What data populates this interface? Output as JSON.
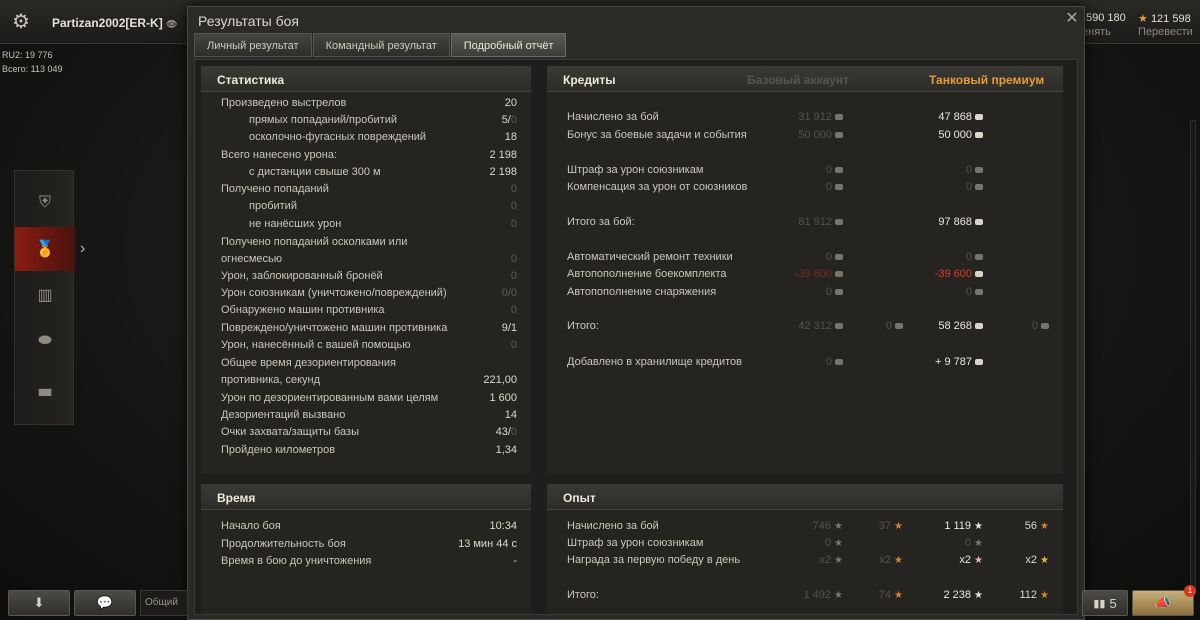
{
  "topbar": {
    "player_name": "Partizan2002[ER-K]",
    "ratings": [
      "RU2: 19 776",
      "Всего: 113 049"
    ],
    "credits_value": "590 180",
    "credits_sub": "енять",
    "gold_value": "121 598",
    "gold_sub": "Перевести"
  },
  "dialog": {
    "title": "Результаты боя",
    "tabs": [
      {
        "label": "Личный результат",
        "active": false
      },
      {
        "label": "Командный результат",
        "active": false
      },
      {
        "label": "Подробный отчёт",
        "active": true
      }
    ]
  },
  "stats": {
    "title": "Статистика",
    "rows": [
      {
        "label": "Произведено выстрелов",
        "value": "20",
        "indent": false,
        "dim": false
      },
      {
        "label": "прямых попаданий/пробитий",
        "value": "5/",
        "value_dim": "0",
        "indent": true
      },
      {
        "label": "осколочно-фугасных повреждений",
        "value": "18",
        "indent": true,
        "dim": false
      },
      {
        "label": "Всего нанесено урона:",
        "value": "2 198",
        "indent": false,
        "dim": false
      },
      {
        "label": "с дистанции свыше 300 м",
        "value": "2 198",
        "indent": true,
        "dim": false
      },
      {
        "label": "Получено попаданий",
        "value": "0",
        "indent": false,
        "dim": true
      },
      {
        "label": "пробитий",
        "value": "0",
        "indent": true,
        "dim": true
      },
      {
        "label": "не нанёсших урон",
        "value": "0",
        "indent": true,
        "dim": true
      },
      {
        "label": "Получено попаданий осколками или",
        "value": "",
        "indent": false,
        "dim": false
      },
      {
        "label": "огнесмесью",
        "value": "0",
        "indent": false,
        "dim": true
      },
      {
        "label": "Урон, заблокированный бронёй",
        "value": "0",
        "indent": false,
        "dim": true
      },
      {
        "label": "Урон союзникам (уничтожено/повреждений)",
        "value": "0/0",
        "indent": false,
        "dim": true
      },
      {
        "label": "Обнаружено машин противника",
        "value": "0",
        "indent": false,
        "dim": true
      },
      {
        "label": "Повреждено/уничтожено машин противника",
        "value": "9/1",
        "indent": false,
        "dim": false
      },
      {
        "label": "Урон, нанесённый с вашей помощью",
        "value": "0",
        "indent": false,
        "dim": true
      },
      {
        "label": "Общее время дезориентирования",
        "value": "",
        "indent": false,
        "dim": false
      },
      {
        "label": "противника, секунд",
        "value": "221,00",
        "indent": false,
        "dim": false
      },
      {
        "label": "Урон по дезориентированным вами целям",
        "value": "1 600",
        "indent": false,
        "dim": false
      },
      {
        "label": "Дезориентаций вызвано",
        "value": "14",
        "indent": false,
        "dim": false
      },
      {
        "label": "Очки захвата/защиты базы",
        "value": "43/",
        "value_dim": "0",
        "indent": false
      },
      {
        "label": "Пройдено километров",
        "value": "1,34",
        "indent": false,
        "dim": false
      }
    ]
  },
  "time": {
    "title": "Время",
    "rows": [
      {
        "label": "Начало боя",
        "value": "10:34"
      },
      {
        "label": "Продолжительность боя",
        "value": "13 мин 44 с"
      },
      {
        "label": "Время в бою до уничтожения",
        "value": "-"
      }
    ]
  },
  "credits": {
    "title": "Кредиты",
    "header_base": "Базовый аккаунт",
    "header_premium": "Танковый премиум",
    "rows": [
      {
        "label": "Начислено за бой",
        "base": "31 912",
        "prem": "47 868"
      },
      {
        "label": "Бонус за боевые задачи и события",
        "base": "50 000",
        "prem": "50 000"
      },
      {
        "label": "Штраф за урон союзникам",
        "base": "0",
        "prem": "0"
      },
      {
        "label": "Компенсация за урон от союзников",
        "base": "0",
        "prem": "0"
      },
      {
        "label": "Итого за бой:",
        "base": "81 912",
        "prem": "97 868"
      },
      {
        "label": "Автоматический ремонт техники",
        "base": "0",
        "prem": "0"
      },
      {
        "label": "Автопополнение боекомплекта",
        "base": "-39 600",
        "prem": "-39 600"
      },
      {
        "label": "Автопополнение снаряжения",
        "base": "0",
        "prem": "0"
      },
      {
        "label": "Итого:",
        "base": "42 312",
        "base_gold": "0",
        "prem": "58 268",
        "prem_gold": "0"
      },
      {
        "label": "Добавлено в хранилище кредитов",
        "base": "0",
        "prem": "+ 9 787"
      }
    ]
  },
  "experience": {
    "title": "Опыт",
    "rows": [
      {
        "label": "Начислено за бой",
        "base": "746",
        "base_free": "37",
        "prem": "1 119",
        "prem_free": "56"
      },
      {
        "label": "Штраф за урон союзникам",
        "base": "0",
        "base_free": "",
        "prem": "0",
        "prem_free": ""
      },
      {
        "label": "Награда за первую победу в день",
        "base": "x2",
        "base_free": "x2",
        "prem": "x2",
        "prem_free": "x2"
      },
      {
        "label": "Итого:",
        "base": "1 492",
        "base_free": "74",
        "prem": "2 238",
        "prem_free": "112"
      }
    ]
  },
  "bottombar": {
    "chat_placeholder": "Общий",
    "squad_count": "5",
    "notification_count": "1"
  }
}
